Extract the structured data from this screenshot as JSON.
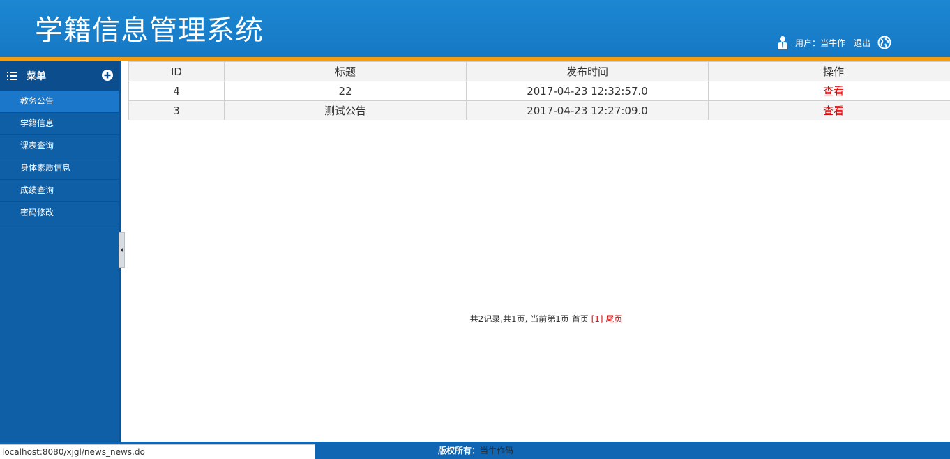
{
  "header": {
    "title": "学籍信息管理系统",
    "user_label": "用户：当牛作",
    "logout_label": "退出"
  },
  "sidebar": {
    "menu_title": "菜单",
    "items": [
      {
        "label": "教务公告",
        "active": true
      },
      {
        "label": "学籍信息"
      },
      {
        "label": "课表查询"
      },
      {
        "label": "身体素质信息"
      },
      {
        "label": "成绩查询"
      },
      {
        "label": "密码修改"
      }
    ]
  },
  "table": {
    "columns": [
      "ID",
      "标题",
      "发布时间",
      "操作"
    ],
    "rows": [
      {
        "id": "4",
        "title": "22",
        "time": "2017-04-23 12:32:57.0",
        "action": "查看"
      },
      {
        "id": "3",
        "title": "测试公告",
        "time": "2017-04-23 12:27:09.0",
        "action": "查看"
      }
    ]
  },
  "pager": {
    "summary": "共2记录,共1页, 当前第1页",
    "first": "首页",
    "current": "[1]",
    "last": "尾页"
  },
  "footer": {
    "label": "版权所有：",
    "owner": "当牛作码"
  },
  "status_url": "localhost:8080/xjgl/news_news.do",
  "colors": {
    "header_blue": "#1678c5",
    "accent_orange": "#f39d12",
    "sidebar_blue": "#0f5fa6",
    "active_item": "#1a77c9",
    "link_red": "#d30d0d"
  }
}
